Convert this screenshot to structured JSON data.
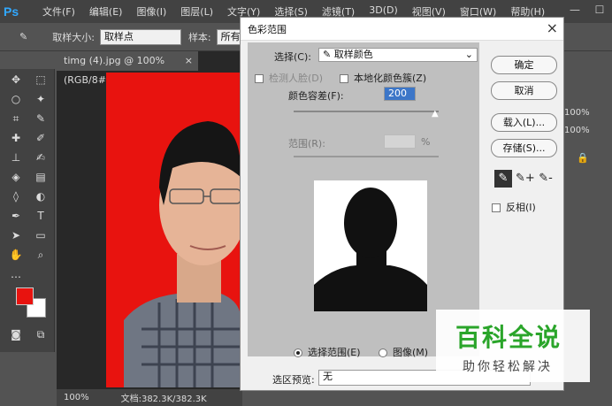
{
  "app": {
    "logo": "Ps"
  },
  "menu": [
    "文件(F)",
    "编辑(E)",
    "图像(I)",
    "图层(L)",
    "文字(Y)",
    "选择(S)",
    "滤镜(T)",
    "3D(D)",
    "视图(V)",
    "窗口(W)",
    "帮助(H)"
  ],
  "options": {
    "sample_size_label": "取样大小:",
    "sample_size_value": "取样点",
    "sample_label": "样本:",
    "sample_value": "所有"
  },
  "document": {
    "tab_title": "timg (4).jpg @ 100%(RGB/8#)",
    "tab_close": "×",
    "zoom": "100%",
    "doc_info": "文档:382.3K/382.3K"
  },
  "right_panel": {
    "pct1": "100%",
    "pct2": "100%"
  },
  "dialog": {
    "title": "色彩范围",
    "select_label": "选择(C):",
    "select_value": "取样颜色",
    "detect_faces": "检测人脸(D)",
    "localized": "本地化颜色簇(Z)",
    "fuzziness_label": "颜色容差(F):",
    "fuzziness_value": "200",
    "range_label": "范围(R):",
    "range_unit": "%",
    "radio_selection": "选择范围(E)",
    "radio_image": "图像(M)",
    "preview_label": "选区预览:",
    "preview_value": "无",
    "ok": "确定",
    "cancel": "取消",
    "load": "载入(L)...",
    "save": "存储(S)...",
    "invert": "反相(I)",
    "close": "×"
  },
  "watermark": {
    "title": "百科全说",
    "subtitle": "助你轻松解决"
  }
}
